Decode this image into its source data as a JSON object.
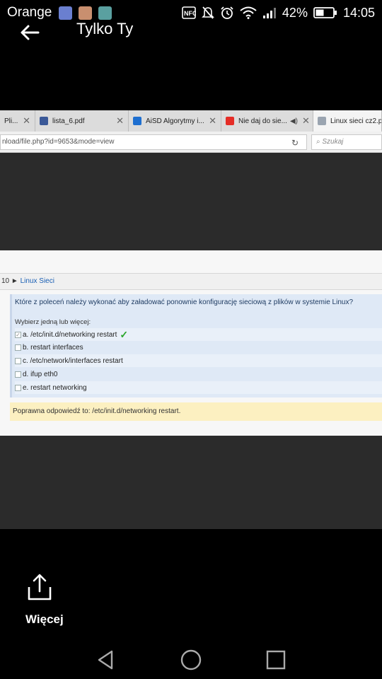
{
  "status_bar": {
    "carrier": "Orange",
    "battery_percent": "42%",
    "time": "14:05",
    "icons": [
      "nfc-icon",
      "mute-icon",
      "alarm-icon",
      "wifi-icon",
      "signal-icon",
      "battery-icon"
    ]
  },
  "app_bar": {
    "title": "Tylko Ty",
    "back_icon": "arrow-left-icon"
  },
  "browser": {
    "tabs": [
      {
        "label": "Pli...",
        "icon_color": "#3a6fb5"
      },
      {
        "label": "lista_6.pdf",
        "icon_color": "#3b5998"
      },
      {
        "label": "AiSD Algorytmy i...",
        "icon_color": "#1e6fd0"
      },
      {
        "label": "Nie daj do sie...",
        "icon_color": "#e52d27"
      },
      {
        "label": "Linux sieci cz2.p",
        "icon_color": "#9aa4b0"
      }
    ],
    "url": "nload/file.php?id=9653&mode=view",
    "search_placeholder": "Szukaj"
  },
  "page": {
    "breadcrumb_prefix": "10 ►",
    "breadcrumb_link": "Linux Sieci",
    "question": "Które z poleceń należy wykonać aby załadować ponownie konfigurację sieciową z plików w systemie Linux?",
    "prompt": "Wybierz jedną lub więcej:",
    "options": [
      {
        "text": "a. /etc/init.d/networking restart",
        "checked": true,
        "correct": true
      },
      {
        "text": "b. restart interfaces",
        "checked": false,
        "correct": false
      },
      {
        "text": "c. /etc/network/interfaces restart",
        "checked": false,
        "correct": false
      },
      {
        "text": "d. ifup eth0",
        "checked": false,
        "correct": false
      },
      {
        "text": "e. restart networking",
        "checked": false,
        "correct": false
      }
    ],
    "answer": "Poprawna odpowiedź to: /etc/init.d/networking restart."
  },
  "share": {
    "label": "Więcej",
    "icon": "share-icon"
  },
  "nav": {
    "icons": [
      "back-triangle-icon",
      "home-circle-icon",
      "recents-square-icon"
    ]
  }
}
